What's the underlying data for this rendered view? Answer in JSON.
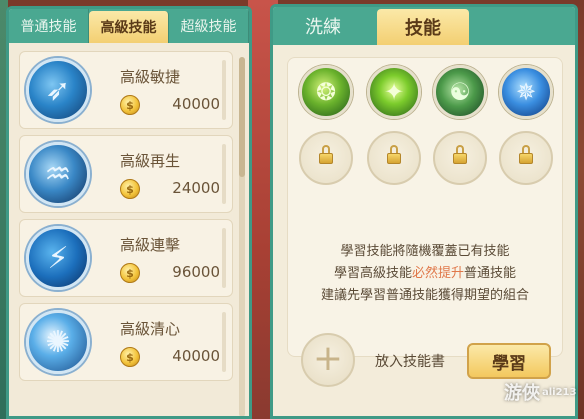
{
  "left_panel": {
    "tabs": [
      {
        "label": "普通技能"
      },
      {
        "label": "高級技能"
      },
      {
        "label": "超級技能"
      }
    ],
    "skills": [
      {
        "name": "高級敏捷",
        "cost": "40000",
        "icon": "bird-icon"
      },
      {
        "name": "高級再生",
        "cost": "24000",
        "icon": "regen-icon"
      },
      {
        "name": "高級連擊",
        "cost": "96000",
        "icon": "combo-icon"
      },
      {
        "name": "高級清心",
        "cost": "40000",
        "icon": "meditation-icon"
      }
    ],
    "coin_icon": "coin-icon",
    "coin_glyph": "$"
  },
  "right_panel": {
    "tabs": [
      {
        "label": "洗練"
      },
      {
        "label": "技能"
      }
    ],
    "skill_slots": [
      {
        "state": "owned",
        "icon": "green-swirl-icon"
      },
      {
        "state": "owned",
        "icon": "green-blade-icon"
      },
      {
        "state": "owned",
        "icon": "green-dragon-icon"
      },
      {
        "state": "owned",
        "icon": "blue-beast-icon"
      },
      {
        "state": "locked",
        "icon": "lock-icon"
      },
      {
        "state": "locked",
        "icon": "lock-icon"
      },
      {
        "state": "locked",
        "icon": "lock-icon"
      },
      {
        "state": "locked",
        "icon": "lock-icon"
      }
    ],
    "info_lines": {
      "line1": "學習技能將隨機覆蓋已有技能",
      "line2_prefix": "學習高級技能",
      "line2_highlight": "必然提升",
      "line2_suffix": "普通技能",
      "line3": "建議先學習普通技能獲得期望的組合"
    },
    "add_book_label": "放入技能書",
    "add_symbol": "+",
    "learn_button": "學習"
  },
  "watermark": {
    "text": "游俠",
    "sub": "ali213"
  },
  "colors": {
    "teal": "#4aa891",
    "gold_tab": "#f3cf72",
    "highlight": "#e0784a",
    "text": "#5a4a36"
  }
}
